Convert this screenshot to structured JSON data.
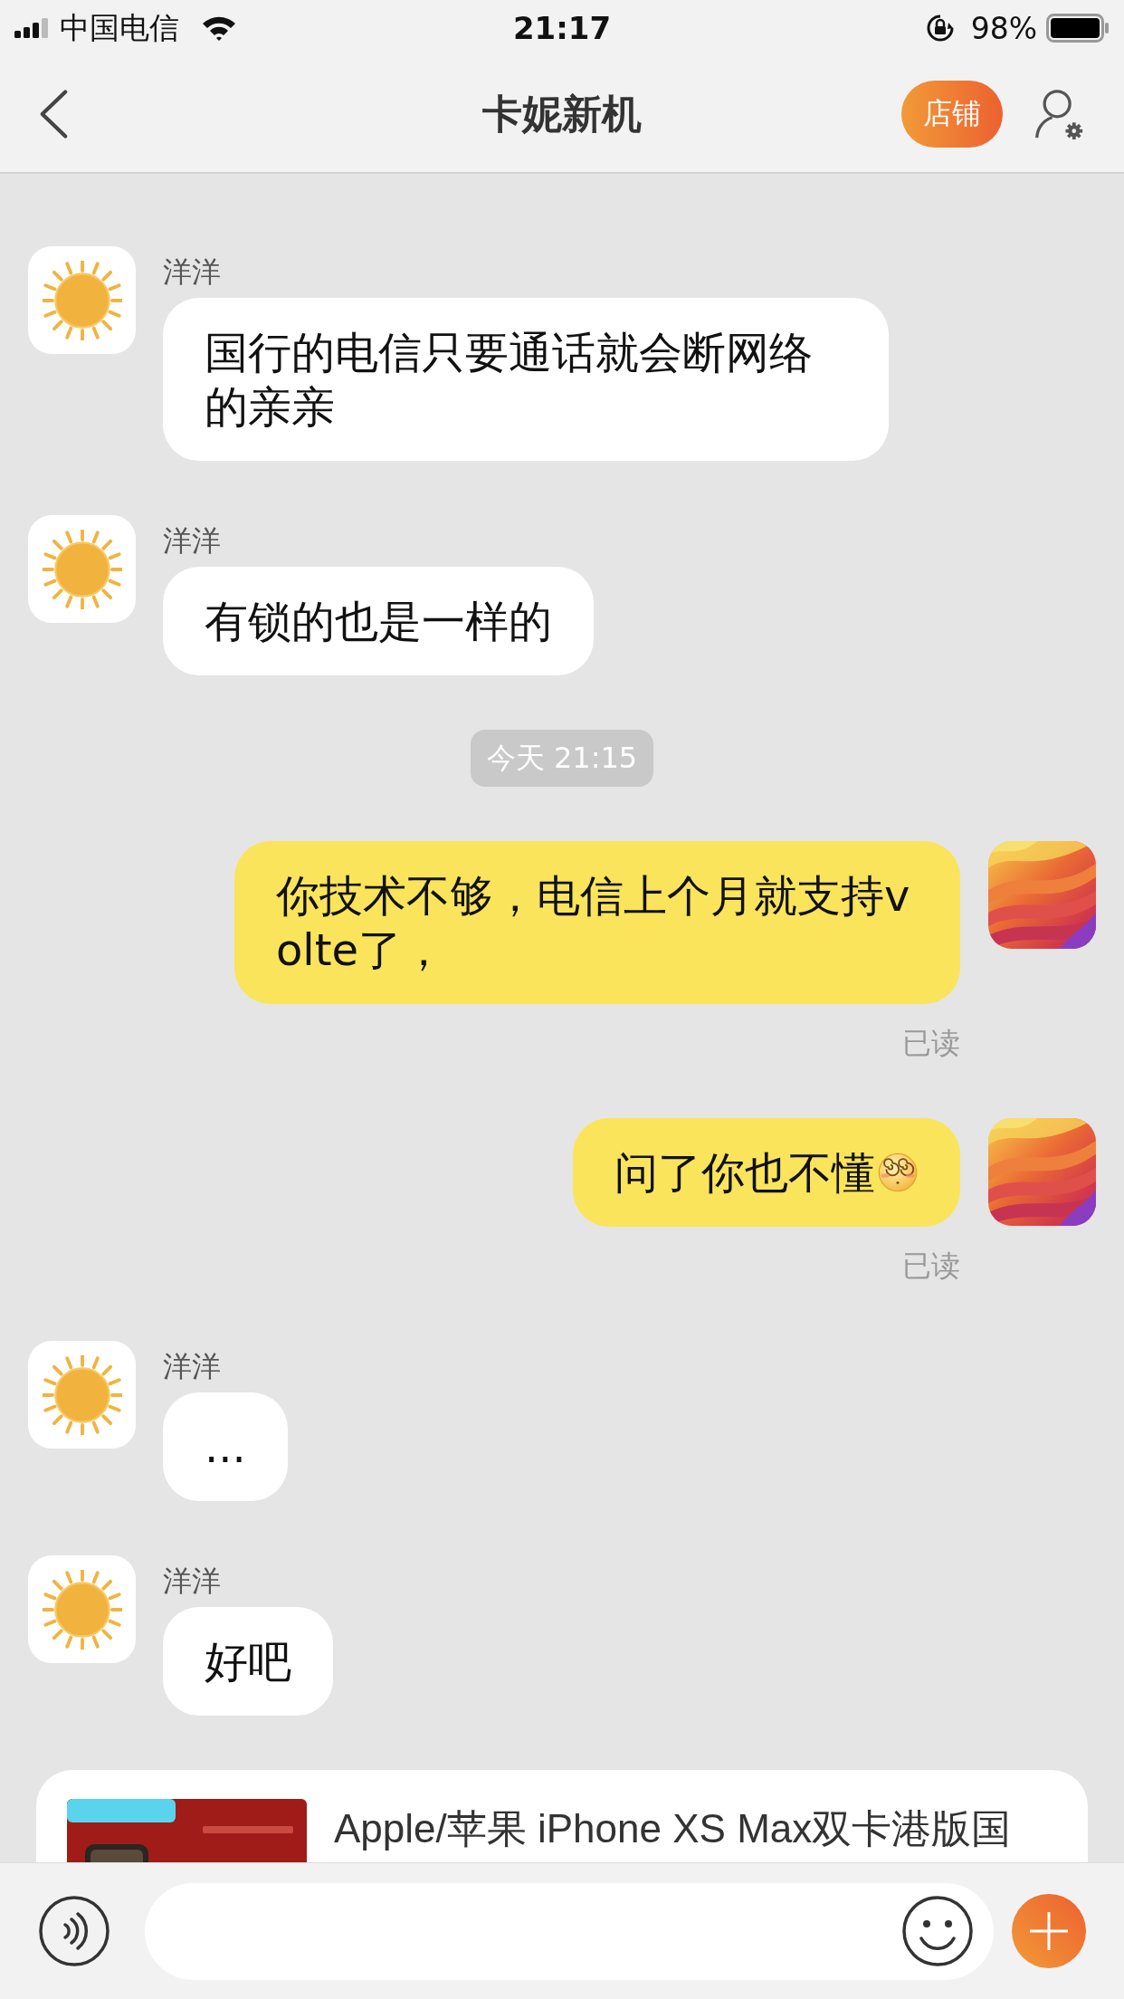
{
  "status_bar": {
    "carrier": "中国电信",
    "time": "21:17",
    "battery": "98%"
  },
  "header": {
    "title": "卡妮新机",
    "shop_button": "店铺"
  },
  "messages": [
    {
      "kind": "incoming",
      "sender": "洋洋",
      "text": "国行的电信只要通话就会断网络的亲亲"
    },
    {
      "kind": "incoming",
      "sender": "洋洋",
      "text": "有锁的也是一样的"
    },
    {
      "kind": "time",
      "text": "今天 21:15"
    },
    {
      "kind": "outgoing",
      "text": "你技术不够，电信上个月就支持volte了，",
      "status": "已读"
    },
    {
      "kind": "outgoing",
      "text": "问了你也不懂",
      "has_emoji": true,
      "status": "已读"
    },
    {
      "kind": "incoming",
      "sender": "洋洋",
      "text": "..."
    },
    {
      "kind": "incoming",
      "sender": "洋洋",
      "text": "好吧"
    }
  ],
  "product_card": {
    "title": "Apple/苹果 iPhone XS Max双卡港版国"
  }
}
